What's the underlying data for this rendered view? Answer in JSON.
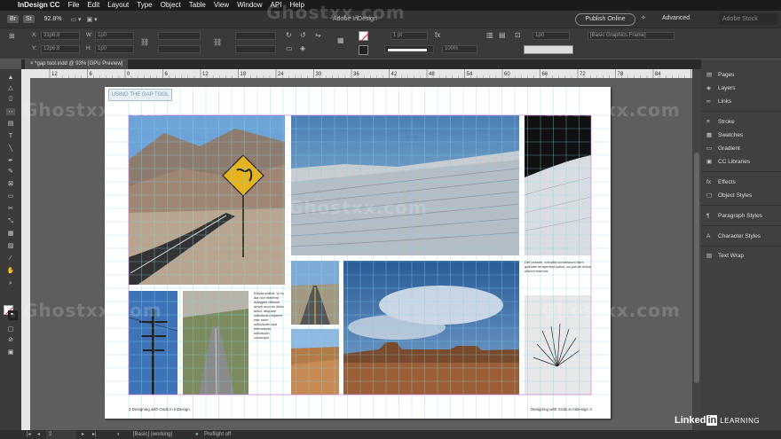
{
  "menubar": {
    "app": "InDesign CC",
    "items": [
      "File",
      "Edit",
      "Layout",
      "Type",
      "Object",
      "Table",
      "View",
      "Window",
      "API",
      "Help"
    ]
  },
  "appbar": {
    "badge1": "Br",
    "badge2": "St",
    "zoom": "92.8%",
    "doc_title": "Adobe InDesign",
    "publish": "Publish Online",
    "workspace": "Advanced",
    "search_placeholder": "Adobe Stock"
  },
  "control": {
    "x_label": "X:",
    "y_label": "Y:",
    "w_label": "W:",
    "h_label": "H:",
    "x_value": "31p6.8",
    "y_value": "12p6.8",
    "w_value": "1p0",
    "h_value": "1p0",
    "stroke_weight": "1 pt",
    "opacity": "100%",
    "frame_size": "1p0",
    "object_style": "[Basic Graphics Frame]"
  },
  "tab": {
    "label": "*gap tool.indd @ 93% [GPU Preview]"
  },
  "ruler_ticks": [
    "12",
    "6",
    "0",
    "6",
    "12",
    "18",
    "24",
    "30",
    "36",
    "42",
    "48",
    "54",
    "60",
    "66",
    "72",
    "78",
    "84",
    "90"
  ],
  "page": {
    "tag": "USING THE GAP TOOL",
    "text_col1": "Ehicta sollicit, vi no aia nicr eleifend dolagest officiati ameti mon se dicta autor, aliquam solicitudin imperet estr neim sollicitudin sed elemolectu solicitudin conseque",
    "text_col2": "Det possim, voluptia conseruium dem quiblam tempertest solicit, ca porum dolos ullores exerunt.",
    "footer_left": "2    Designing with Grids in InDesign",
    "footer_right": "Designing with Grids in InDesign    3"
  },
  "panels": {
    "items": [
      "Pages",
      "Layers",
      "Links",
      "Stroke",
      "Swatches",
      "Gradient",
      "CC Libraries",
      "Effects",
      "Object Styles",
      "Paragraph Styles",
      "Character Styles",
      "Text Wrap"
    ]
  },
  "status": {
    "page_number": "2",
    "style": "[Basic] (working)",
    "preflight": "Preflight off"
  },
  "branding": {
    "linkedin": "Linked",
    "in": "in",
    "learning": "LEARNING"
  },
  "watermark": "Ghostxx.com",
  "colors": {
    "menubar": "#1b1b1b",
    "appbar": "#333333",
    "panel": "#404040",
    "pasteboard": "#5e5e5e",
    "page": "#ffffff",
    "guide": "#7fd4e8",
    "frame_selection": "#6b7fff"
  }
}
